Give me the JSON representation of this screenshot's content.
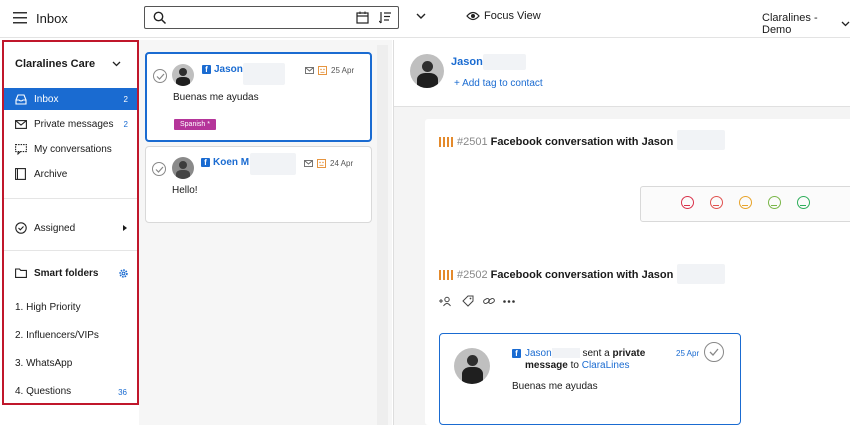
{
  "topbar": {
    "title": "Inbox",
    "search_placeholder": "",
    "focus_view_label": "Focus View",
    "account_label": "Claralines - Demo"
  },
  "sidebar": {
    "brand": "Claralines Care",
    "items": [
      {
        "label": "Inbox",
        "count": "2",
        "icon": "inbox-icon",
        "active": true
      },
      {
        "label": "Private messages",
        "count": "2",
        "icon": "envelope-icon",
        "active": false
      },
      {
        "label": "My conversations",
        "count": "",
        "icon": "chat-icon",
        "active": false
      },
      {
        "label": "Archive",
        "count": "",
        "icon": "archive-icon",
        "active": false
      }
    ],
    "assigned_label": "Assigned",
    "smart_folders_label": "Smart folders",
    "folders": [
      {
        "label": "1. High Priority",
        "count": ""
      },
      {
        "label": "2. Influencers/VIPs",
        "count": ""
      },
      {
        "label": "3. WhatsApp",
        "count": ""
      },
      {
        "label": "4. Questions",
        "count": "36"
      }
    ]
  },
  "conversations": [
    {
      "name": "Jason",
      "date": "25 Apr",
      "message": "Buenas me ayudas",
      "tag": "Spanish *",
      "selected": true
    },
    {
      "name": "Koen M",
      "date": "24 Apr",
      "message": "Hello!",
      "tag": "",
      "selected": false
    }
  ],
  "detail": {
    "contact_name": "Jason",
    "add_tag_label": "+ Add tag to contact",
    "conversation_1": {
      "id": "#2501",
      "title": "Facebook conversation with Jason"
    },
    "conversation_2": {
      "id": "#2502",
      "title": "Facebook conversation with Jason"
    },
    "sentiment_colors": [
      "#d9324b",
      "#e0524f",
      "#e8a42b",
      "#7ab648",
      "#2fae5b"
    ],
    "message": {
      "sender": "Jason",
      "text_mid": "sent a",
      "text_bold": "private message",
      "text_to": "to",
      "recipient": "ClaraLines",
      "date": "25 Apr",
      "body": "Buenas me ayudas"
    }
  },
  "colors": {
    "accent": "#1a6bd1",
    "highlight_border": "#c0172b",
    "tag": "#b5359a",
    "bars": "#e48a2c"
  }
}
